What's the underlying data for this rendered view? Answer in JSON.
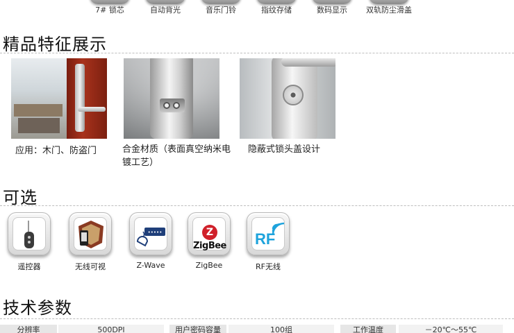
{
  "top_features": [
    "7# 锁芯",
    "自动背光",
    "音乐门铃",
    "指纹存储",
    "数码显示",
    "双轨防尘滑盖"
  ],
  "sections": {
    "features_title": "精品特征展示",
    "options_title": "可选",
    "specs_title": "技术参数"
  },
  "photos": [
    {
      "caption": "应用：木门、防盗门"
    },
    {
      "caption_line1": "合金材质（表面真空纳米电",
      "caption_line2": "镀工艺）"
    },
    {
      "caption": "隐蔽式锁头盖设计"
    }
  ],
  "options": [
    {
      "label": "遥控器",
      "icon": "remote-control-icon"
    },
    {
      "label": "无线可视",
      "icon": "wireless-video-icon"
    },
    {
      "label": "Z-Wave",
      "icon": "zwave-icon"
    },
    {
      "label": "ZigBee",
      "icon": "zigbee-icon",
      "logo_text": "ZigBee",
      "logo_mark": "Z"
    },
    {
      "label": "RF无线",
      "icon": "rf-wireless-icon",
      "logo_text": "RF"
    }
  ],
  "specs": [
    {
      "key": "分辨率",
      "value": "500DPI"
    },
    {
      "key": "用户密码容量",
      "value": "100组"
    },
    {
      "key": "工作温度",
      "value": "－20℃～55℃"
    }
  ],
  "colors": {
    "accent_red": "#d0202a",
    "rf_blue": "#1ea3dc",
    "door_red": "#a8321c"
  }
}
